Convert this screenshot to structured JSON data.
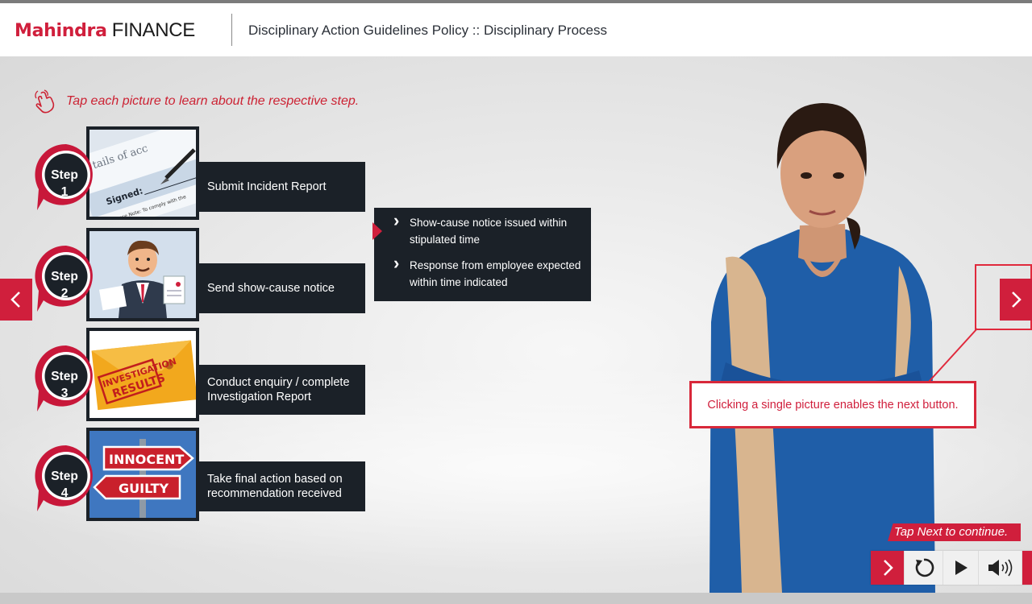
{
  "header": {
    "logo_brand": "Mahindra",
    "logo_suffix": "FINANCE",
    "title": "Disciplinary Action Guidelines Policy :: Disciplinary Process"
  },
  "instruction": "Tap each picture to learn about the respective step.",
  "steps": [
    {
      "word": "Step",
      "number": "1",
      "label": "Submit Incident Report",
      "icon": "signed-form-icon"
    },
    {
      "word": "Step",
      "number": "2",
      "label": "Send show-cause notice",
      "icon": "businessman-notice-icon"
    },
    {
      "word": "Step",
      "number": "3",
      "label": "Conduct enquiry / complete Investigation Report",
      "icon": "investigation-envelope-icon"
    },
    {
      "word": "Step",
      "number": "4",
      "label": "Take final action based on recommendation received",
      "icon": "innocent-guilty-sign-icon"
    }
  ],
  "popup": {
    "items": [
      "Show-cause notice issued within stipulated time",
      "Response from employee expected within time indicated"
    ]
  },
  "callout": "Clicking a single picture enables the next button.",
  "tap_next": "Tap Next to continue.",
  "colors": {
    "accent": "#d01f3c",
    "dark": "#1b2128"
  }
}
